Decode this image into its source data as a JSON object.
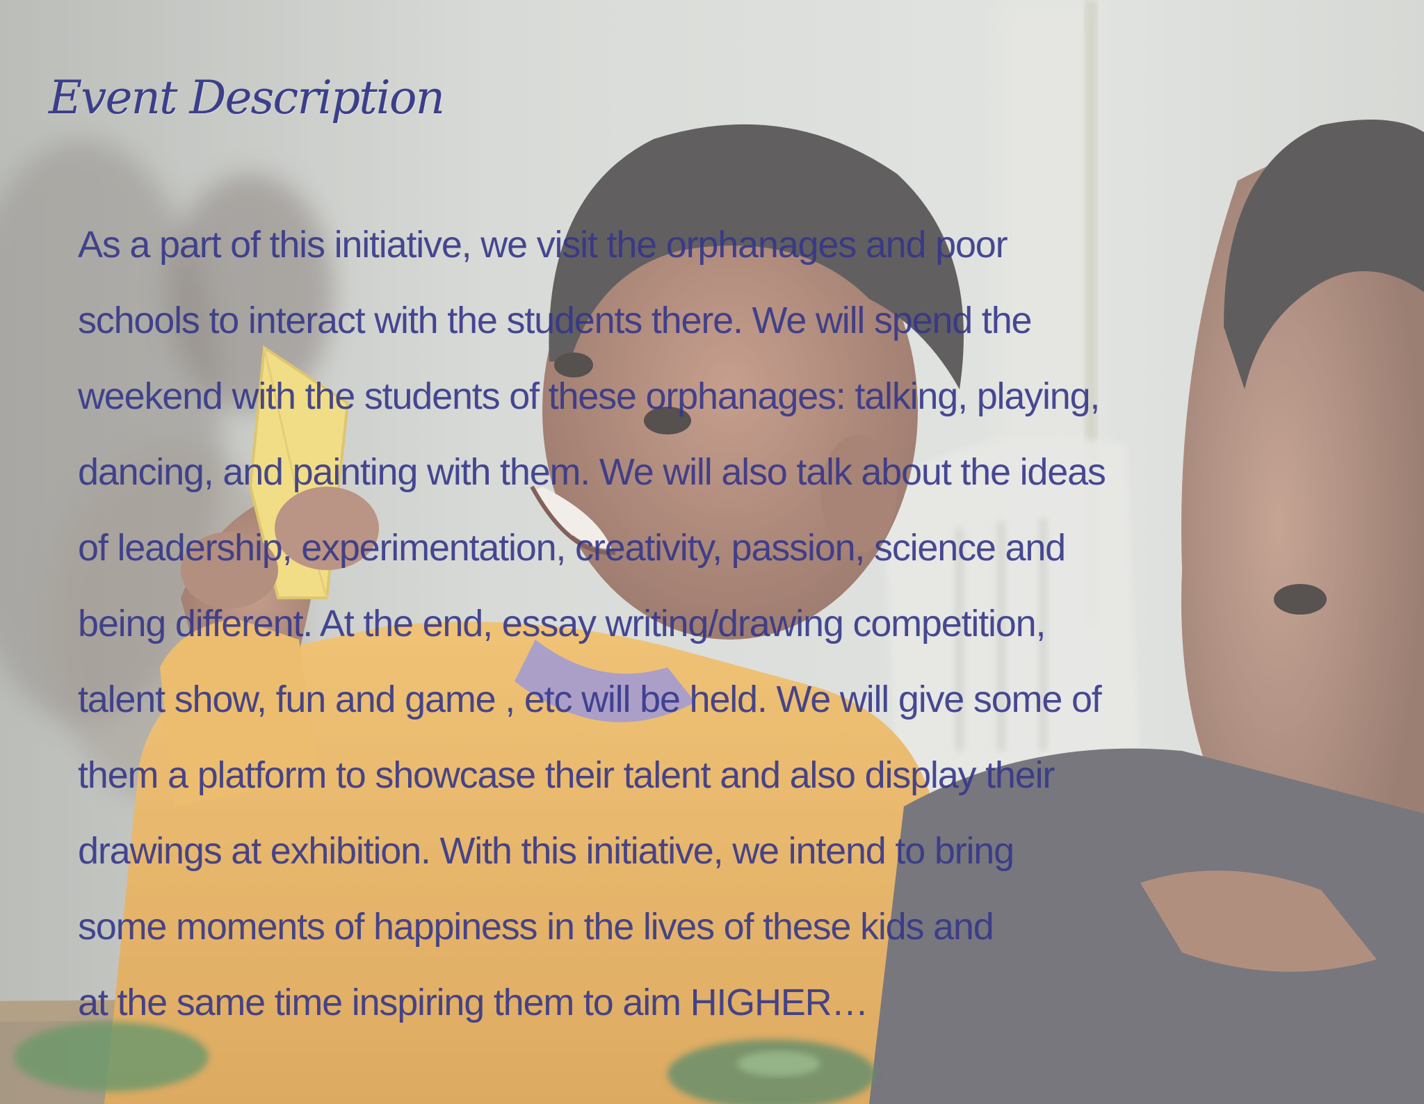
{
  "title": "Event Description",
  "description_lines": [
    "As a part of this initiative, we visit the orphanages and poor",
    "schools to interact with the students there. We will spend the",
    "weekend with the students of these orphanages: talking, playing,",
    "dancing, and painting with them. We will also talk about the ideas",
    "of leadership, experimentation, creativity, passion, science and",
    "being different. At the end, essay writing/drawing competition,",
    "talent show, fun and game , etc will be held. We will give some of",
    "them a platform to showcase their talent and also display their",
    "drawings at exhibition. With this initiative, we intend to bring",
    "some moments of happiness in the lives of these kids and",
    "at the same time inspiring them to aim HIGHER…"
  ],
  "colors": {
    "title": "#3b3f8a",
    "body_text": "#35378a",
    "shirt": "#e9a93d",
    "wall": "#c9cbc6"
  }
}
